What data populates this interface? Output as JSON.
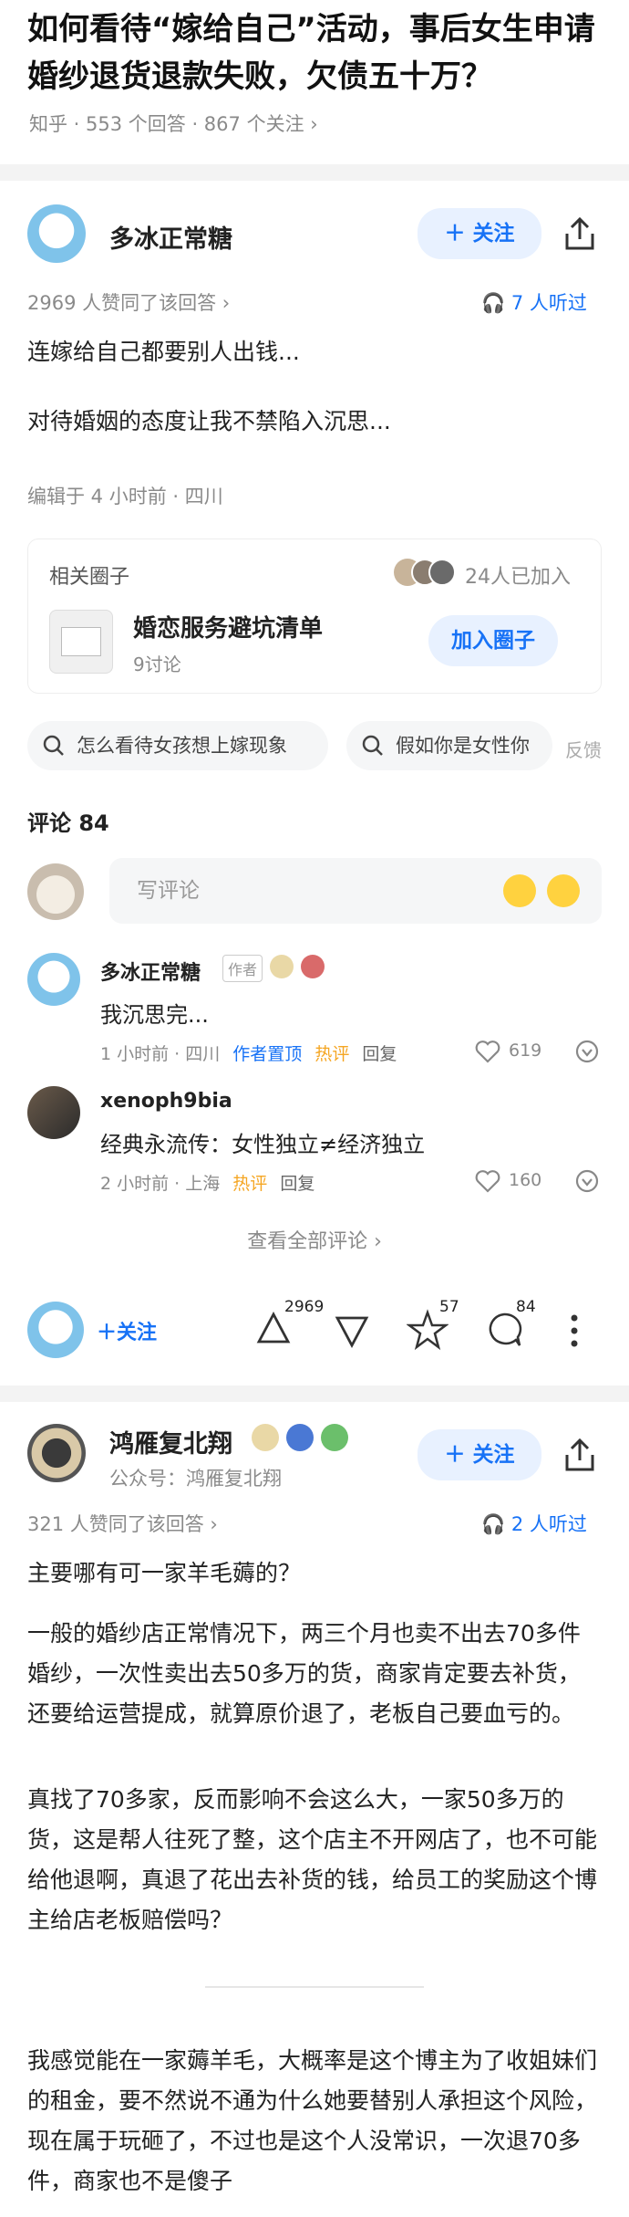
{
  "question": {
    "title": "如何看待“嫁给自己”活动，事后女生申请婚纱退货退款失败，欠债五十万？",
    "meta": "知乎 · 553 个回答 · 867 个关注 ›"
  },
  "answer1": {
    "author": "多冰正常糖",
    "follow_label": "＋ 关注",
    "upvote_text": "2969 人赞同了该回答 ›",
    "listen_text": "7 人听过",
    "paragraphs": [
      "连嫁给自己都要别人出钱...",
      "对待婚姻的态度让我不禁陷入沉思..."
    ],
    "edited": "编辑于 4 小时前 · 四川",
    "circle": {
      "header": "相关圈子",
      "members": "24人已加入",
      "name": "婚恋服务避坑清单",
      "discussions": "9讨论",
      "join_label": "加入圈子"
    },
    "chips": [
      "怎么看待女孩想上嫁现象",
      "假如你是女性你"
    ],
    "feedback": "反馈",
    "comments_title": "评论 84",
    "comment_placeholder": "写评论",
    "comments": [
      {
        "name": "多冰正常糖",
        "badge": "作者",
        "text": "我沉思完...",
        "time": "1 小时前 · 四川",
        "tag1": "作者置顶",
        "tag2": "热评",
        "reply": "回复",
        "likes": "619"
      },
      {
        "name": "xenoph9bia",
        "text": "经典永流传：女性独立≠经济独立",
        "time": "2 小时前 · 上海",
        "tag2": "热评",
        "reply": "回复",
        "likes": "160"
      }
    ],
    "view_all": "查看全部评论 ›",
    "bottom": {
      "follow_label": "＋关注",
      "up_count": "2969",
      "star_count": "57",
      "comment_count": "84"
    }
  },
  "answer2": {
    "author": "鸿雁复北翔",
    "subtitle": "公众号：鸿雁复北翔",
    "follow_label": "＋ 关注",
    "upvote_text": "321 人赞同了该回答 ›",
    "listen_text": "2 人听过",
    "paragraphs": [
      "主要哪有可一家羊毛薅的？",
      "一般的婚纱店正常情况下，两三个月也卖不出去70多件婚纱，一次性卖出去50多万的货，商家肯定要去补货，还要给运营提成，就算原价退了，老板自己要血亏的。",
      "真找了70多家，反而影响不会这么大，一家50多万的货，这是帮人往死了整，这个店主不开网店了，也不可能给他退啊，真退了花出去补货的钱，给员工的奖励这个博主给店老板赔偿吗？",
      "我感觉能在一家薅羊毛，大概率是这个博主为了收姐妹们的租金，要不然说不通为什么她要替别人承担这个风险，现在属于玩砸了，不过也是这个人没常识，一次退70多件，商家也不是傻子"
    ]
  },
  "colors": {
    "accent": "#1772f6",
    "hot": "#f5a623",
    "grey": "#8a8a8a"
  }
}
